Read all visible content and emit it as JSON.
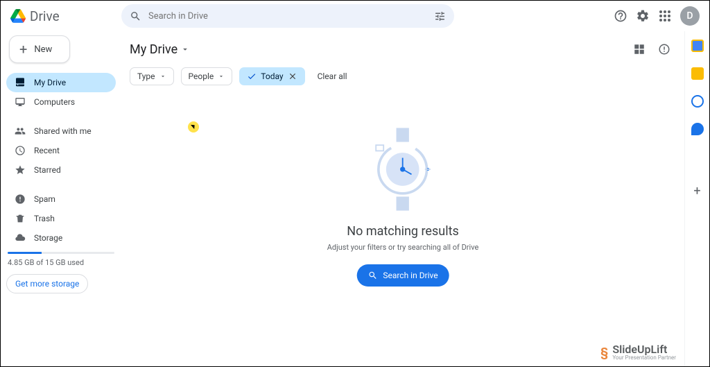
{
  "header": {
    "product": "Drive",
    "search_placeholder": "Search in Drive",
    "avatar_initial": "D"
  },
  "sidebar": {
    "new_label": "New",
    "items": [
      {
        "label": "My Drive"
      },
      {
        "label": "Computers"
      },
      {
        "label": "Shared with me"
      },
      {
        "label": "Recent"
      },
      {
        "label": "Starred"
      },
      {
        "label": "Spam"
      },
      {
        "label": "Trash"
      },
      {
        "label": "Storage"
      }
    ],
    "storage_text": "4.85 GB of 15 GB used",
    "storage_cta": "Get more storage"
  },
  "main": {
    "breadcrumb": "My Drive",
    "filters": {
      "type": "Type",
      "people": "People",
      "today": "Today",
      "clear": "Clear all"
    },
    "empty": {
      "title": "No matching results",
      "subtitle": "Adjust your filters or try searching all of Drive",
      "button": "Search in Drive"
    }
  },
  "watermark": {
    "name": "SlideUpLift",
    "tag": "Your Presentation Partner"
  }
}
